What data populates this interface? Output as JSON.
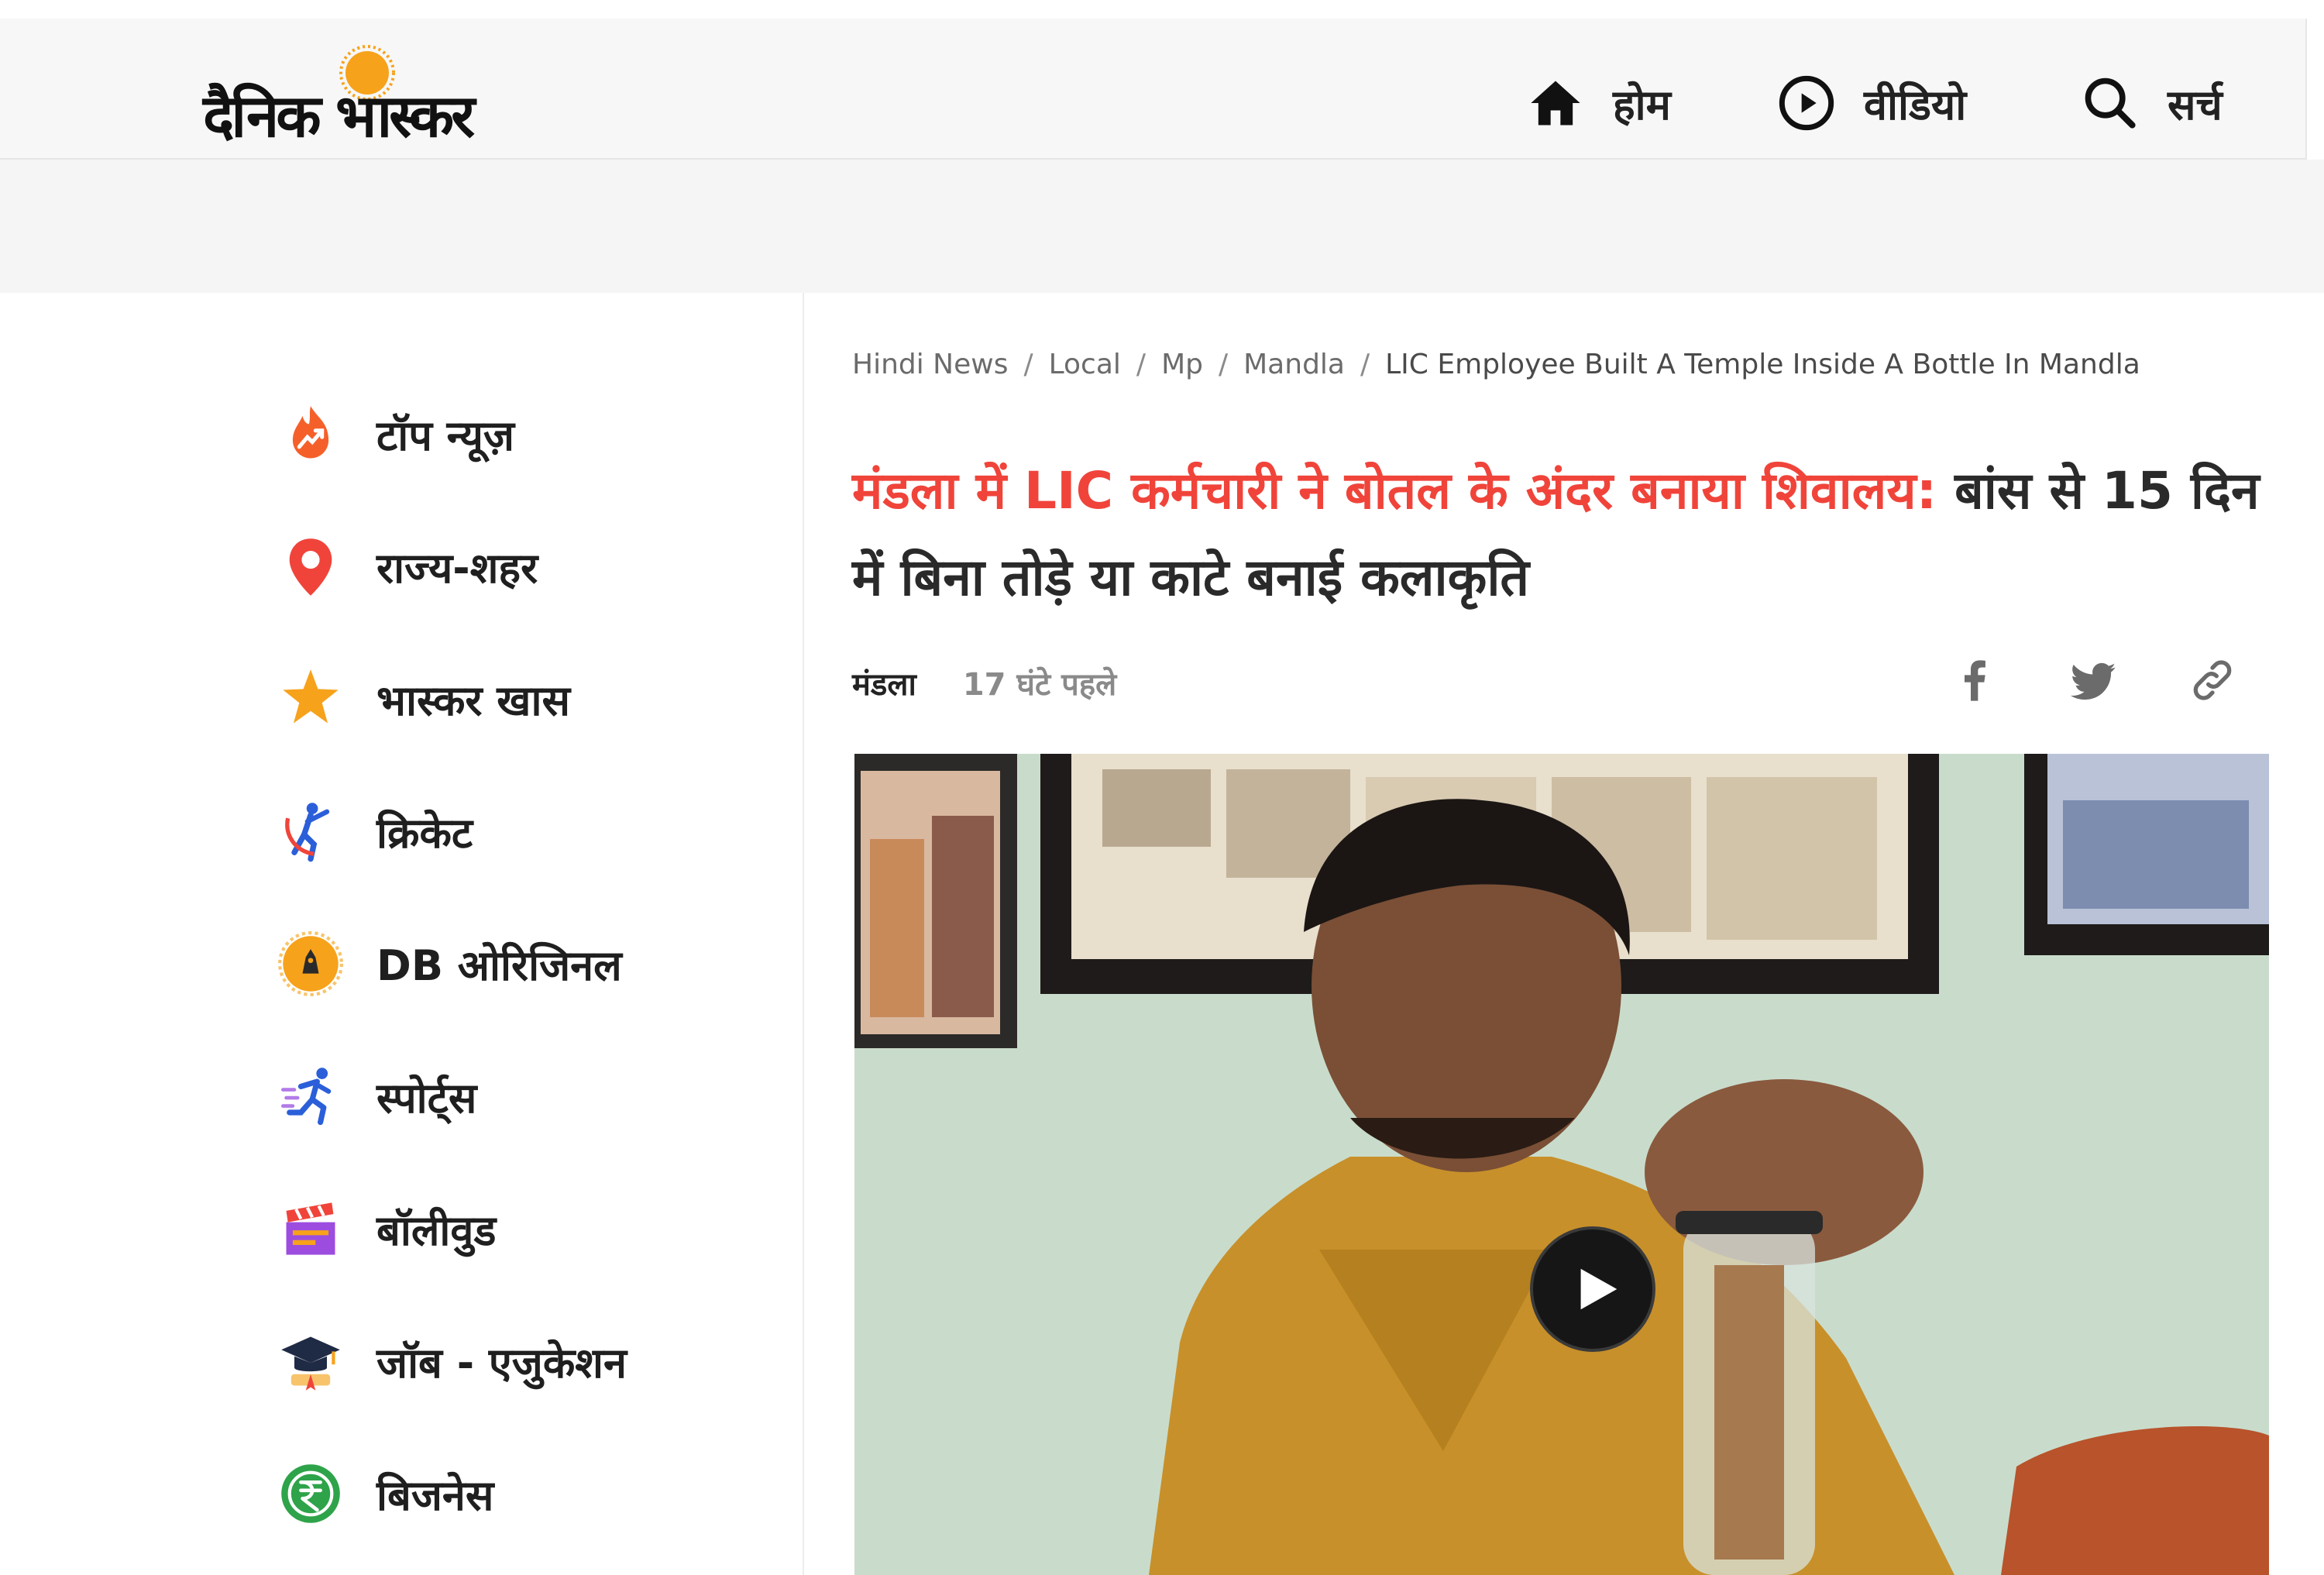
{
  "header": {
    "logo_text": "दैनिक भास्कर",
    "nav": [
      {
        "label": "होम",
        "icon": "home-icon"
      },
      {
        "label": "वीडियो",
        "icon": "play-circle-icon"
      },
      {
        "label": "सर्च",
        "icon": "search-icon"
      }
    ]
  },
  "sidebar": {
    "items": [
      {
        "label": "टॉप न्यूज़",
        "icon": "flame-trend-icon"
      },
      {
        "label": "राज्य-शहर",
        "icon": "map-pin-icon"
      },
      {
        "label": "भास्कर खास",
        "icon": "star-icon"
      },
      {
        "label": "क्रिकेट",
        "icon": "cricket-icon"
      },
      {
        "label": "DB ओरिजिनल",
        "icon": "db-original-icon"
      },
      {
        "label": "स्पोर्ट्स",
        "icon": "runner-icon"
      },
      {
        "label": "बॉलीवुड",
        "icon": "clapperboard-icon"
      },
      {
        "label": "जॉब - एजुकेशन",
        "icon": "graduation-cap-icon"
      },
      {
        "label": "बिजनेस",
        "icon": "rupee-icon"
      }
    ]
  },
  "article": {
    "breadcrumb": [
      "Hindi News",
      "Local",
      "Mp",
      "Mandla",
      "LIC Employee Built A Temple Inside A Bottle In Mandla"
    ],
    "headline_highlight": "मंडला में LIC कर्मचारी ने बोतल के अंदर बनाया शिवालय:",
    "headline_rest": " बांस से 15 दिन में बिना तोड़े या काटे बनाई कलाकृति",
    "location": "मंडला",
    "time_ago": "17 घंटे पहले",
    "share": [
      "facebook-icon",
      "twitter-icon",
      "link-icon"
    ]
  },
  "colors": {
    "accent_red": "#f0443a",
    "logo_sun": "#f7a21b",
    "header_bg": "#f7f7f7"
  }
}
